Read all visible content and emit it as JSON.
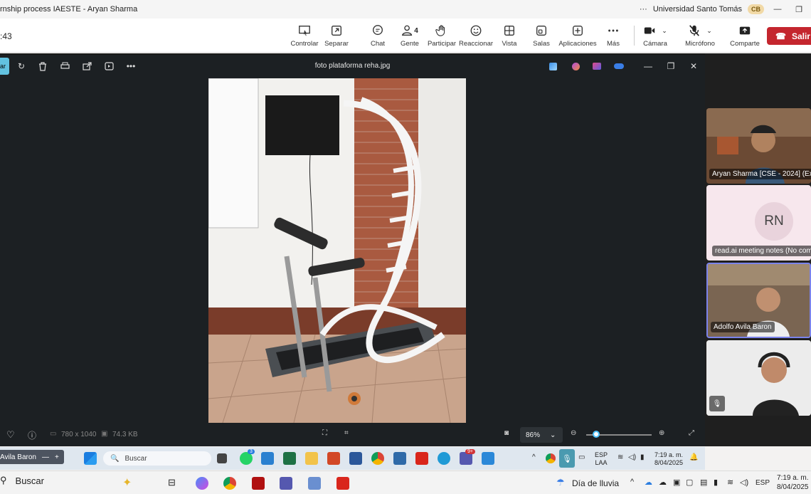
{
  "window": {
    "title": "rnship process IAESTE - Aryan Sharma",
    "org": "Universidad Santo Tomás",
    "org_badge": "CB",
    "more": "···"
  },
  "meeting": {
    "elapsed": ":43",
    "salir": "Salir",
    "people_count": "4",
    "buttons": [
      {
        "id": "controlar",
        "label": "Controlar"
      },
      {
        "id": "separar",
        "label": "Separar"
      },
      {
        "id": "chat",
        "label": "Chat"
      },
      {
        "id": "gente",
        "label": "Gente"
      },
      {
        "id": "participar",
        "label": "Participar"
      },
      {
        "id": "reaccionar",
        "label": "Reaccionar"
      },
      {
        "id": "vista",
        "label": "Vista"
      },
      {
        "id": "salas",
        "label": "Salas"
      },
      {
        "id": "aplicaciones",
        "label": "Aplicaciones"
      },
      {
        "id": "mas",
        "label": "Más"
      },
      {
        "id": "camara",
        "label": "Cámara"
      },
      {
        "id": "microfono",
        "label": "Micrófono"
      },
      {
        "id": "comparte",
        "label": "Comparte"
      }
    ]
  },
  "viewer": {
    "tab_label": "ar",
    "filename": "foto plataforma reha.jpg",
    "dimensions": "780 x 1040",
    "filesize": "74.3 KB",
    "zoom": "86%",
    "zoom_level": 0.15
  },
  "participants": [
    {
      "name": "Aryan Sharma [CSE - 2024] (Ext..."
    },
    {
      "initials": "RN",
      "name": "read.ai meeting notes (No com..."
    },
    {
      "name": "Adolfo Avila Baron"
    },
    {
      "name": ""
    }
  ],
  "inner_taskbar": {
    "active_window": "Avila Baron",
    "search": "Buscar",
    "lang1": "ESP",
    "lang2": "LAA",
    "time": "7:19 a. m.",
    "date": "8/04/2025",
    "badges": [
      "3",
      "9+"
    ]
  },
  "outer_taskbar": {
    "search": "Buscar",
    "weather": "Día de lluvia",
    "lang": "ESP",
    "time": "7:19 a. m.",
    "date": "8/04/2025"
  }
}
